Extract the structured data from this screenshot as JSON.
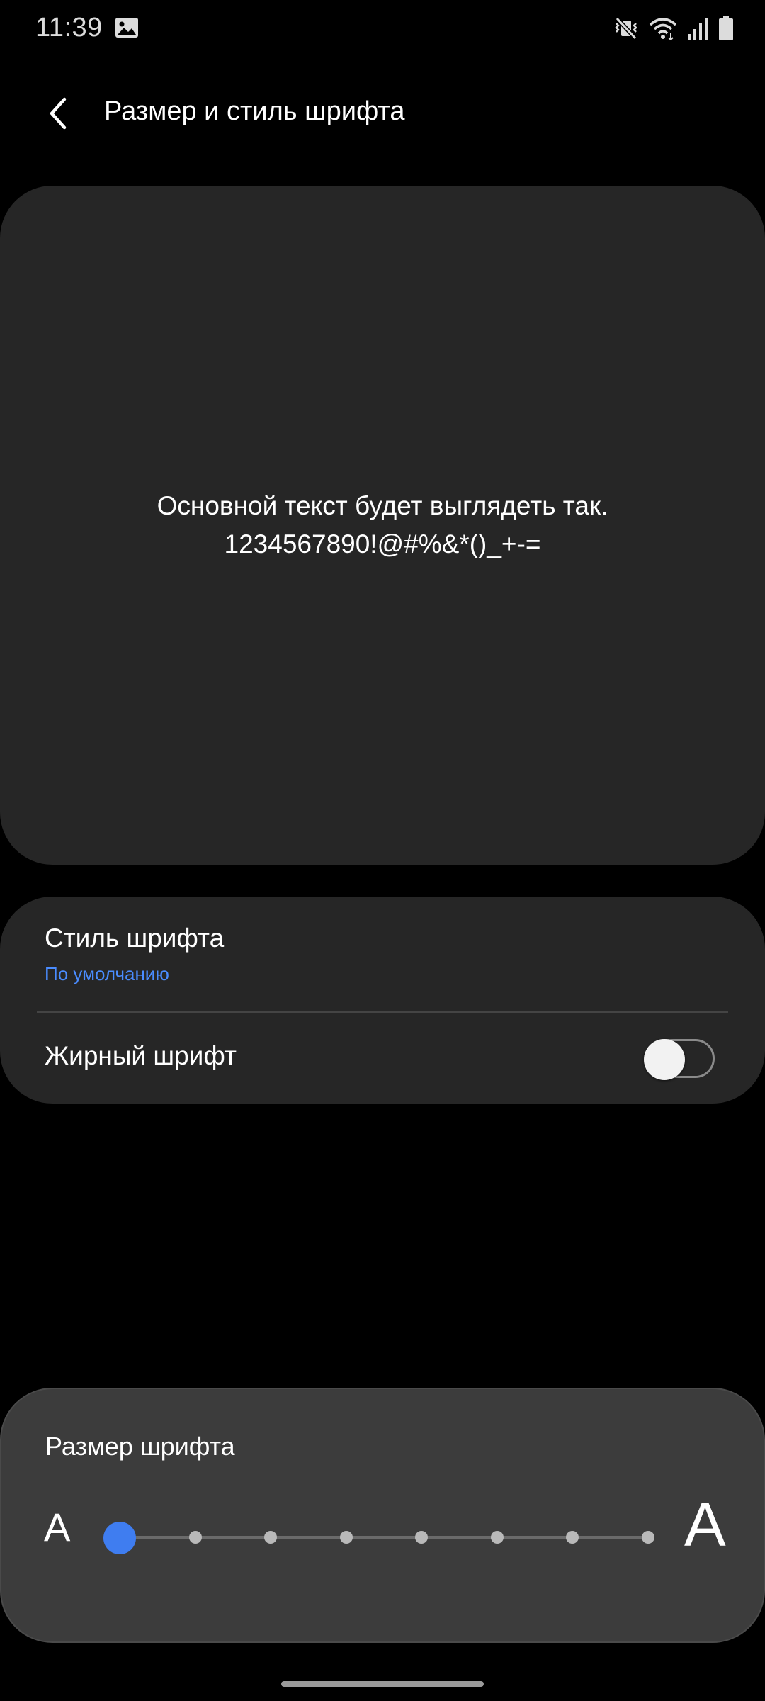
{
  "status_bar": {
    "time": "11:39",
    "icons": [
      "gallery-icon",
      "mute-vibrate-icon",
      "wifi-icon",
      "signal-icon",
      "battery-icon"
    ]
  },
  "header": {
    "title": "Размер и стиль шрифта",
    "back_icon": "chevron-left-icon"
  },
  "preview": {
    "line1": "Основной текст будет выглядеть так.",
    "line2": "1234567890!@#%&*()_+-="
  },
  "settings": {
    "font_style": {
      "title": "Стиль шрифта",
      "value": "По умолчанию"
    },
    "bold_font": {
      "title": "Жирный шрифт",
      "enabled": false
    }
  },
  "font_size": {
    "title": "Размер шрифта",
    "small_label": "A",
    "large_label": "A",
    "level": 1,
    "levels": 8
  },
  "colors": {
    "background": "#000000",
    "card": "#262626",
    "panel": "#3c3c3c",
    "accent": "#3f7df0",
    "subtitle_accent": "#4a8cff"
  }
}
